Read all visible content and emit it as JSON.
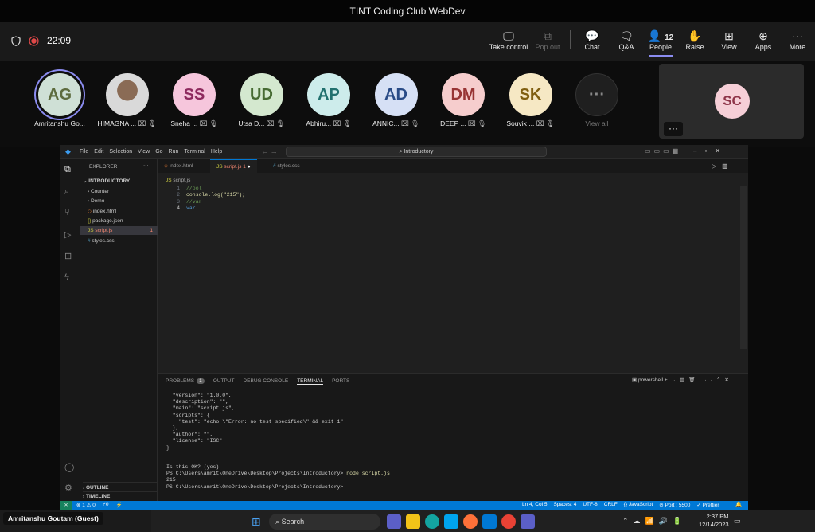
{
  "meeting": {
    "title": "TINT Coding Club WebDev",
    "timer": "22:09",
    "self_label": "Amritanshu Goutam (Guest)"
  },
  "toolbar": [
    {
      "label": "Take control",
      "icon": "take-control-icon"
    },
    {
      "label": "Pop out",
      "icon": "pop-out-icon"
    },
    {
      "label": "Chat",
      "icon": "chat-icon"
    },
    {
      "label": "Q&A",
      "icon": "qa-icon"
    },
    {
      "label": "People",
      "icon": "people-icon",
      "count": "12"
    },
    {
      "label": "Raise",
      "icon": "raise-hand-icon"
    },
    {
      "label": "View",
      "icon": "view-icon"
    },
    {
      "label": "Apps",
      "icon": "apps-icon"
    },
    {
      "label": "More",
      "icon": "more-icon"
    }
  ],
  "participants": [
    {
      "initials": "AG",
      "name": "Amritanshu Go...",
      "color": "#cfe0d6",
      "text": "#5d6b3e"
    },
    {
      "initials": "",
      "name": "HIMAGNA ...",
      "color": "#d8d8d8",
      "text": "#333333"
    },
    {
      "initials": "SS",
      "name": "Sneha ...",
      "color": "#f6c6dc",
      "text": "#8e2a5e"
    },
    {
      "initials": "UD",
      "name": "Utsa D...",
      "color": "#d4e8cf",
      "text": "#476b33"
    },
    {
      "initials": "AP",
      "name": "Abhiru...",
      "color": "#cdeceb",
      "text": "#21716f"
    },
    {
      "initials": "AD",
      "name": "ANNIC...",
      "color": "#d6e0f5",
      "text": "#294b87"
    },
    {
      "initials": "DM",
      "name": "DEEP ...",
      "color": "#f6cdcd",
      "text": "#983434"
    },
    {
      "initials": "SK",
      "name": "Souvik ...",
      "color": "#f6e8c4",
      "text": "#805f10"
    }
  ],
  "view_all": {
    "label": "View all"
  },
  "spotlight": {
    "initials": "SC",
    "color": "#f6cfd7",
    "text": "#8e3448"
  },
  "vscode": {
    "menu": [
      "File",
      "Edit",
      "Selection",
      "View",
      "Go",
      "Run",
      "Terminal",
      "Help"
    ],
    "search": "Introductory",
    "explorer_title": "EXPLORER",
    "project": "INTRODUCTORY",
    "files": [
      {
        "name": "Counter",
        "kind": "folder"
      },
      {
        "name": "Demo",
        "kind": "folder"
      },
      {
        "name": "index.html",
        "kind": "html"
      },
      {
        "name": "package.json",
        "kind": "json"
      },
      {
        "name": "script.js",
        "kind": "js",
        "badge": "1"
      },
      {
        "name": "styles.css",
        "kind": "css"
      }
    ],
    "outline": "OUTLINE",
    "timeline": "TIMELINE",
    "tabs": [
      {
        "name": "index.html"
      },
      {
        "name": "script.js",
        "badge": "1"
      },
      {
        "name": "styles.css"
      }
    ],
    "breadcrumb": "script.js",
    "code_lines": [
      {
        "num": "1",
        "text": "//ool"
      },
      {
        "num": "2",
        "text": "console.log(\"215\");"
      },
      {
        "num": "3",
        "text": "//var"
      },
      {
        "num": "4",
        "text": "var"
      }
    ],
    "panel_tabs": [
      "PROBLEMS",
      "OUTPUT",
      "DEBUG CONSOLE",
      "TERMINAL",
      "PORTS"
    ],
    "problems_count": "1",
    "shell": "powershell",
    "terminal_lines": [
      "  \"version\": \"1.0.0\",",
      "  \"description\": \"\",",
      "  \"main\": \"script.js\",",
      "  \"scripts\": {",
      "    \"test\": \"echo \\\"Error: no test specified\\\" && exit 1\"",
      "  },",
      "  \"author\": \"\",",
      "  \"license\": \"ISC\"",
      "}",
      "",
      "",
      "Is this OK? (yes)",
      "PS C:\\Users\\amrit\\OneDrive\\Desktop\\Projects\\Introductory> node script.js",
      "215",
      "PS C:\\Users\\amrit\\OneDrive\\Desktop\\Projects\\Introductory> "
    ],
    "status_left": [
      "⊗ 1 ⚠ 0",
      "⑂0",
      "⚡"
    ],
    "status_right": [
      "Ln 4, Col 5",
      "Spaces: 4",
      "UTF-8",
      "CRLF",
      "{} JavaScript",
      "⊘ Port : 5500",
      "✓ Prettier"
    ]
  },
  "taskbar": {
    "search": "Search",
    "time": "2:37 PM",
    "date": "12/14/2023"
  }
}
